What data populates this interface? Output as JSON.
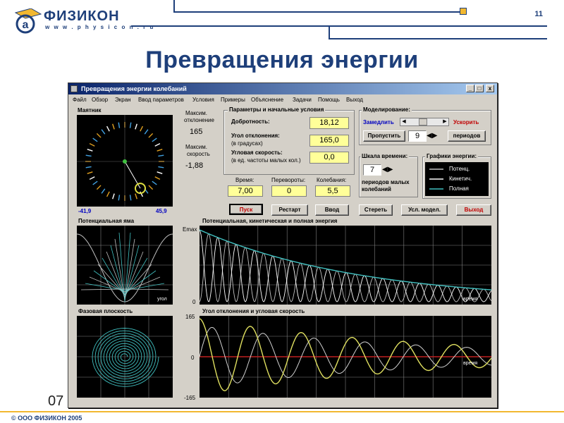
{
  "slide": {
    "logo_name": "ФИЗИКОН",
    "logo_url": "w w w . p h y s i c o n . r u",
    "number": "11",
    "title": "Превращения энергии",
    "side_number": "07",
    "footer": "© ООО ФИЗИКОН 2005"
  },
  "window": {
    "title": "Превращения энергии колебаний",
    "minimize": "_",
    "maximize": "□",
    "close": "x"
  },
  "menu": [
    "Файл",
    "Обзор",
    "Экран",
    "Ввод параметров",
    "Условия",
    "Примеры",
    "Объяснение",
    "Задачи",
    "Помощь",
    "Выход"
  ],
  "pendulum": {
    "label": "Маятник",
    "min_value": "-41,9",
    "max_value": "45,9"
  },
  "extremes": {
    "max_deflection_label_1": "Максим.",
    "max_deflection_label_2": "отклонение",
    "max_deflection_value": "165",
    "max_speed_label_1": "Максим.",
    "max_speed_label_2": "скорость",
    "max_speed_value": "-1,88"
  },
  "params": {
    "group_title": "Параметры и начальные условия",
    "quality_label": "Добротность:",
    "quality_value": "18,12",
    "angle_label": "Угол отклонения:",
    "angle_unit": "(в градусах)",
    "angle_value": "165,0",
    "angular_speed_label": "Угловая скорость:",
    "angular_speed_unit": "(в ед. частоты малых кол.)",
    "angular_speed_value": "0,0"
  },
  "modeling": {
    "group_title": "Моделирование:",
    "slower": "Замедлить",
    "faster": "Ускорить",
    "skip_button": "Пропустить",
    "skip_value": "9",
    "periods_button": "периодов"
  },
  "timescale": {
    "group_title": "Шкала времени:",
    "value": "7",
    "label_1": "периодов малых",
    "label_2": "колебаний"
  },
  "energy_legend": {
    "group_title": "Графики энергии:",
    "potential": "Потенц.",
    "kinetic": "Кинетич.",
    "total": "Полная"
  },
  "readouts": {
    "time_label": "Время:",
    "time_value": "7,00",
    "flips_label": "Перевороты:",
    "flips_value": "0",
    "oscillations_label": "Колебания:",
    "oscillations_value": "5,5"
  },
  "buttons": {
    "start": "Пуск",
    "restart": "Рестарт",
    "input": "Ввод",
    "erase": "Стереть",
    "conditions": "Усл. модел.",
    "exit": "Выход"
  },
  "potential_well": {
    "label": "Потенциальная яма",
    "axis_label": "угол"
  },
  "energy_plot": {
    "label": "Потенциальная, кинетическая и полная энергия",
    "y_max": "Emax",
    "y_zero": "0",
    "x_label": "время"
  },
  "phase_plane": {
    "label": "Фазовая плоскость"
  },
  "angle_plot": {
    "label": "Угол отклонения и угловая скорость",
    "y_top": "165",
    "y_mid": "0",
    "y_bottom": "-165",
    "x_label": "время"
  },
  "colors": {
    "brand": "#1e3f7a",
    "potential": "#c0c0c0",
    "kinetic": "#ffffff",
    "total": "#40c0c0",
    "angle": "#e0e060",
    "zero_line": "#c02020"
  }
}
